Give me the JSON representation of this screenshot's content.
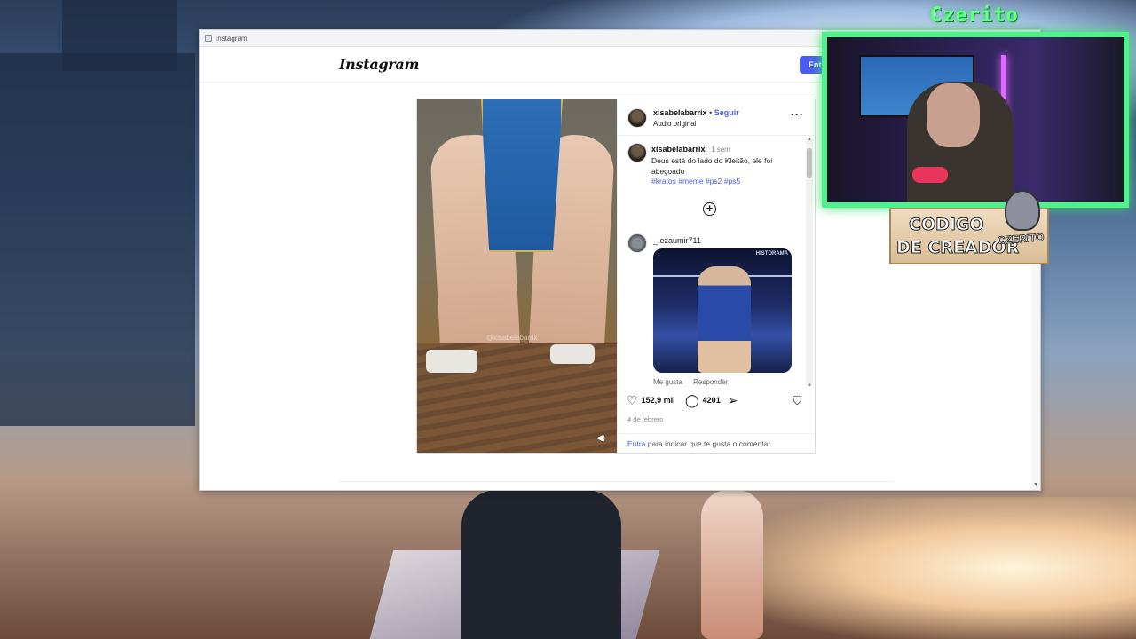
{
  "window": {
    "title": "Instagram"
  },
  "header": {
    "logo": "Instagram",
    "login_button": "Entra"
  },
  "post": {
    "author": "xisabelabarrix",
    "separator": "•",
    "follow_label": "Seguir",
    "audio_label": "Audio original",
    "more_icon": "more-horizontal-icon",
    "media_watermark": "@xisabelabarrix",
    "caption": {
      "author": "xisabelabarrix",
      "time": "1 sem",
      "text": "Deus está do lado do Kleitão, ele foi abeçoado",
      "hashtags": "#kratos #meme #ps2 #ps5"
    },
    "comment": {
      "author": "_.ezaumir711",
      "gif_text": "HISTORAMA",
      "like_label": "Me gusta",
      "reply_label": "Responder"
    },
    "likes": "152,9 mil",
    "comments_count": "4201",
    "date": "4 de febrero",
    "login_prompt_link": "Entra",
    "login_prompt_text": "para indicar que te gusta o comentar."
  },
  "overlay": {
    "streamer_name": "Czerito",
    "code_line1": "CODIGO",
    "code_line2": "DE CREADOR",
    "code_tag": "CZERITO"
  },
  "colors": {
    "accent": "#4a5cf0",
    "overlay_green": "#52f08a"
  }
}
